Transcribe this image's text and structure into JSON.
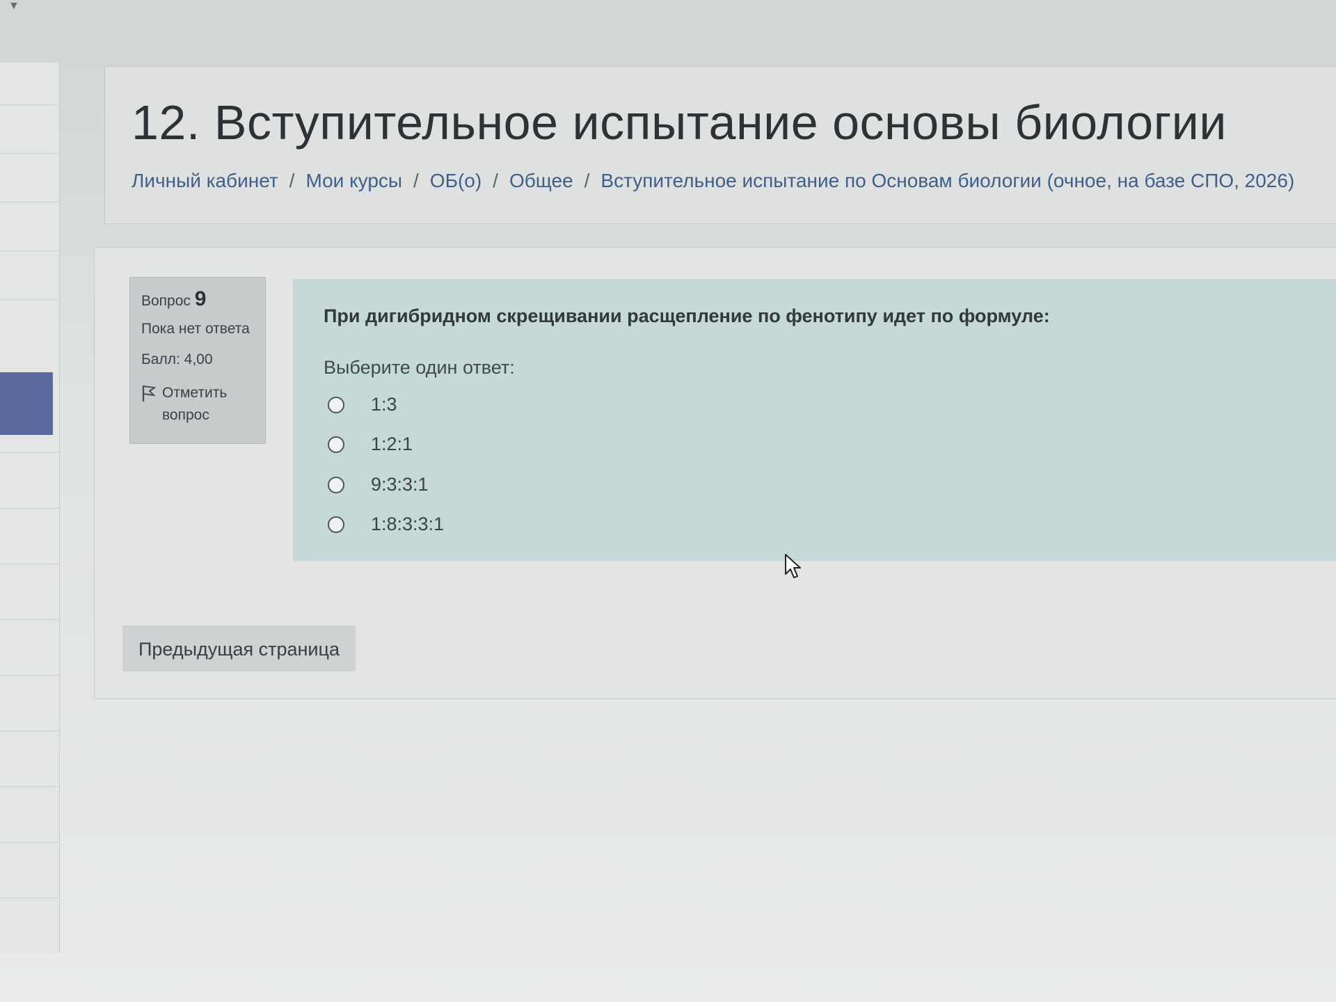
{
  "header": {
    "title": "12. Вступительное испытание основы биологии",
    "breadcrumb": [
      "Личный кабинет",
      "Мои курсы",
      "ОБ(о)",
      "Общее",
      "Вступительное испытание по Основам биологии (очное, на базе СПО, 2026)"
    ],
    "separator": "/"
  },
  "question": {
    "label": "Вопрос",
    "number": "9",
    "state": "Пока нет ответа",
    "grade": "Балл: 4,00",
    "flag_label": "Отметить вопрос",
    "text": "При дигибридном скрещивании расщепление по фенотипу идет по формуле:",
    "prompt": "Выберите один ответ:",
    "answers": [
      "1:3",
      "1:2:1",
      "9:3:3:1",
      "1:8:3:3:1"
    ],
    "selected": null
  },
  "navigation": {
    "prev_label": "Предыдущая страница"
  },
  "colors": {
    "accent_nav": "#5b6a9e",
    "question_bg": "#c6d9d9",
    "link": "#3d5f8a"
  },
  "icons": {
    "flag": "flag-icon",
    "cursor": "mouse-pointer-icon",
    "dropdown": "chevron-down-icon"
  }
}
